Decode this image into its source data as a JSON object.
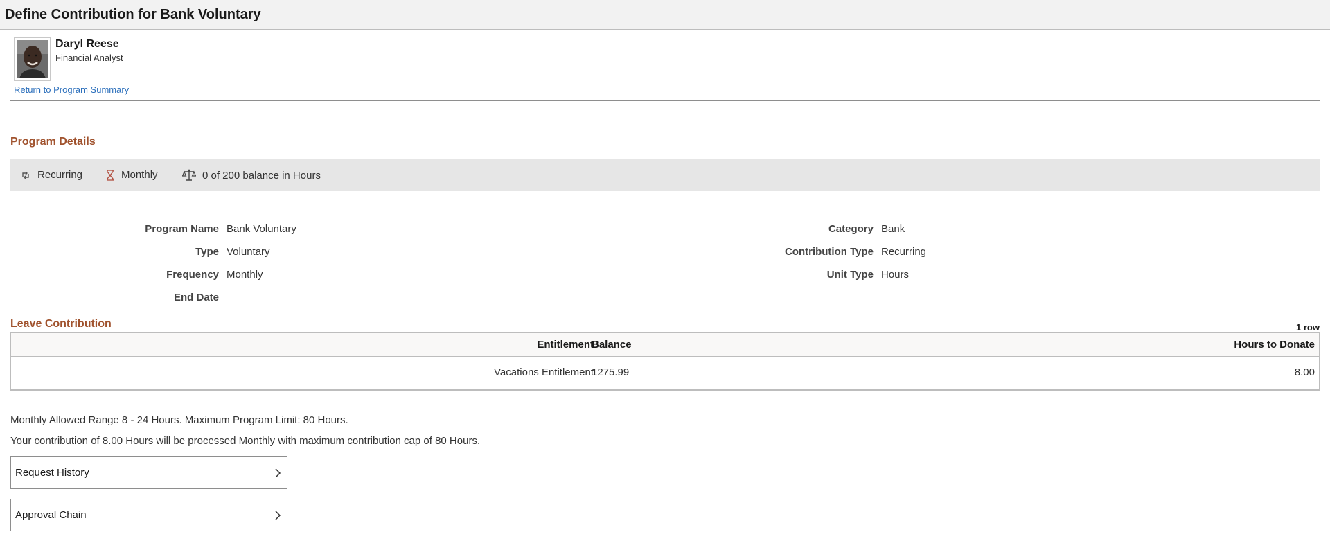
{
  "page": {
    "title": "Define Contribution for Bank Voluntary"
  },
  "employee": {
    "name": "Daryl Reese",
    "job_title": "Financial Analyst",
    "return_link": "Return to Program Summary"
  },
  "program_details": {
    "heading": "Program Details",
    "summary": {
      "recurring": "Recurring",
      "frequency": "Monthly",
      "balance": "0 of 200 balance in Hours"
    },
    "fields": {
      "program_name_label": "Program Name",
      "program_name": "Bank Voluntary",
      "type_label": "Type",
      "type": "Voluntary",
      "frequency_label": "Frequency",
      "frequency": "Monthly",
      "end_date_label": "End Date",
      "end_date": "",
      "category_label": "Category",
      "category": "Bank",
      "contribution_type_label": "Contribution Type",
      "contribution_type": "Recurring",
      "unit_type_label": "Unit Type",
      "unit_type": "Hours"
    }
  },
  "leave_contribution": {
    "heading": "Leave Contribution",
    "row_count": "1 row",
    "columns": {
      "entitlement": "Entitlement",
      "balance": "Balance",
      "hours": "Hours to Donate"
    },
    "rows": [
      {
        "entitlement": "Vacations Entitlement",
        "balance": "1275.99",
        "hours": "8.00"
      }
    ]
  },
  "messages": {
    "range": "Monthly Allowed Range 8 - 24 Hours. Maximum Program Limit: 80 Hours.",
    "processing": "Your contribution of 8.00 Hours will be processed Monthly with maximum contribution cap of 80 Hours."
  },
  "navigation": {
    "request_history": "Request History",
    "approval_chain": "Approval Chain"
  },
  "icons": [
    "recurring-icon",
    "hourglass-icon",
    "balance-scale-icon",
    "chevron-right-icon"
  ],
  "colors": {
    "section_heading": "#a0522d",
    "link": "#2a6ebb",
    "summary_bg": "#e6e6e6"
  }
}
